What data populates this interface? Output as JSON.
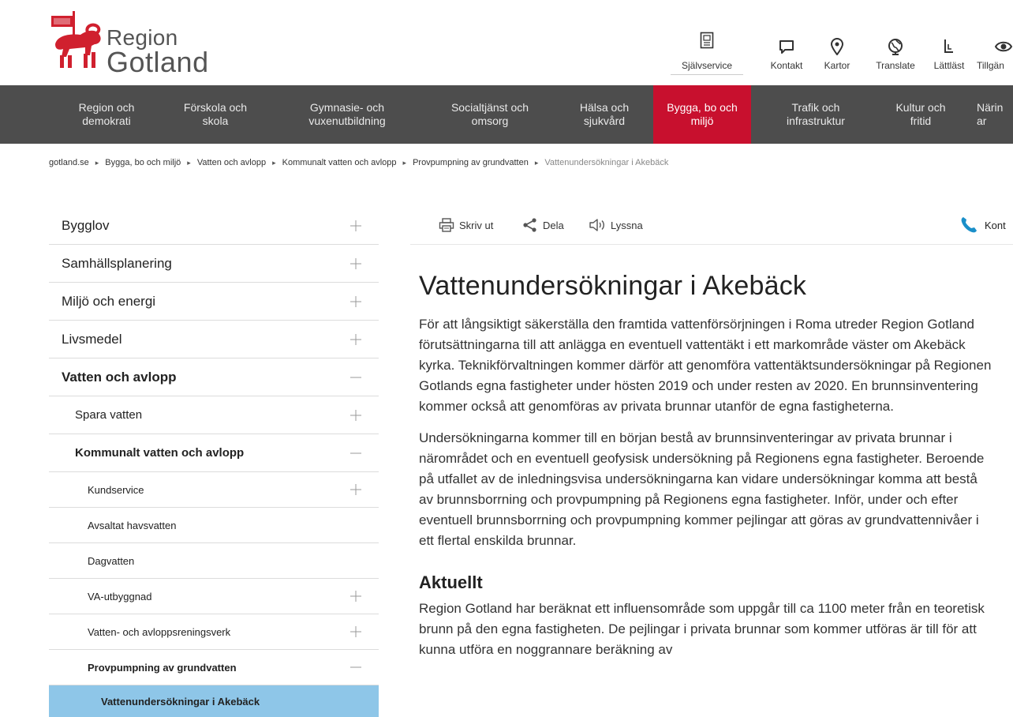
{
  "logo": {
    "line1": "Region",
    "line2": "Gotland"
  },
  "utility": {
    "selfservice": "Självservice",
    "kontakt": "Kontakt",
    "kartor": "Kartor",
    "translate": "Translate",
    "lattlast": "Lättläst",
    "tillganglighet": "Tillgän"
  },
  "nav": [
    {
      "label": "Region och\ndemokrati"
    },
    {
      "label": "Förskola och\nskola"
    },
    {
      "label": "Gymnasie- och\nvuxenutbildning"
    },
    {
      "label": "Socialtjänst och\nomsorg"
    },
    {
      "label": "Hälsa och\nsjukvård"
    },
    {
      "label": "Bygga, bo och\nmiljö"
    },
    {
      "label": "Trafik och\ninfrastruktur"
    },
    {
      "label": "Kultur och\nfritid"
    },
    {
      "label": "Närin\nar"
    }
  ],
  "breadcrumb": [
    "gotland.se",
    "Bygga, bo och miljö",
    "Vatten och avlopp",
    "Kommunalt vatten och avlopp",
    "Provpumpning av grundvatten",
    "Vattenundersökningar i Akebäck"
  ],
  "sidebar": [
    {
      "label": "Bygglov"
    },
    {
      "label": "Samhällsplanering"
    },
    {
      "label": "Miljö och energi"
    },
    {
      "label": "Livsmedel"
    },
    {
      "label": "Vatten och avlopp"
    },
    {
      "label": "Spara vatten"
    },
    {
      "label": "Kommunalt vatten och avlopp"
    },
    {
      "label": "Kundservice"
    },
    {
      "label": "Avsaltat havsvatten"
    },
    {
      "label": "Dagvatten"
    },
    {
      "label": "VA-utbyggnad"
    },
    {
      "label": "Vatten- och avloppsreningsverk"
    },
    {
      "label": "Provpumpning av grundvatten"
    },
    {
      "label": "Vattenundersökningar i Akebäck"
    }
  ],
  "tools": {
    "print": "Skriv ut",
    "share": "Dela",
    "listen": "Lyssna",
    "contact": "Kont"
  },
  "article": {
    "title": "Vattenundersökningar i Akebäck",
    "p1": "För att långsiktigt säkerställa den framtida vattenförsörjningen i Roma utreder Region Gotland förutsättningarna till att anlägga en eventuell vattentäkt i ett markområde väster om Akebäck kyrka. Teknikförvaltningen kommer därför att genomföra vattentäktsundersökningar på Regionen Gotlands egna fastigheter under hösten 2019 och under resten av 2020. En brunnsinventering kommer också att genomföras av privata brunnar utanför de egna fastigheterna.",
    "p2": "Undersökningarna kommer till en början bestå av brunnsinventeringar av privata brunnar i närområdet och en eventuell geofysisk undersökning på Regionens egna fastigheter. Beroende på utfallet av de inledningsvisa undersökningarna kan vidare undersökningar komma att bestå av brunnsborrning och provpumpning på Regionens egna fastigheter. Inför, under och efter eventuell brunnsborrning och provpumpning kommer pejlingar att göras av grundvattennivåer i ett flertal enskilda brunnar.",
    "h2": "Aktuellt",
    "p3": "Region Gotland har beräknat ett influensområde som uppgår till ca 1100 meter från en teoretisk brunn på den egna fastigheten. De pejlingar i privata brunnar som kommer utföras är till för att kunna utföra en noggrannare beräkning av"
  },
  "colors": {
    "brand_red": "#c8102e",
    "nav_bg": "#4d4d4d",
    "active_sidebar": "#8ec6e8",
    "phone_icon": "#1a8fc9"
  }
}
